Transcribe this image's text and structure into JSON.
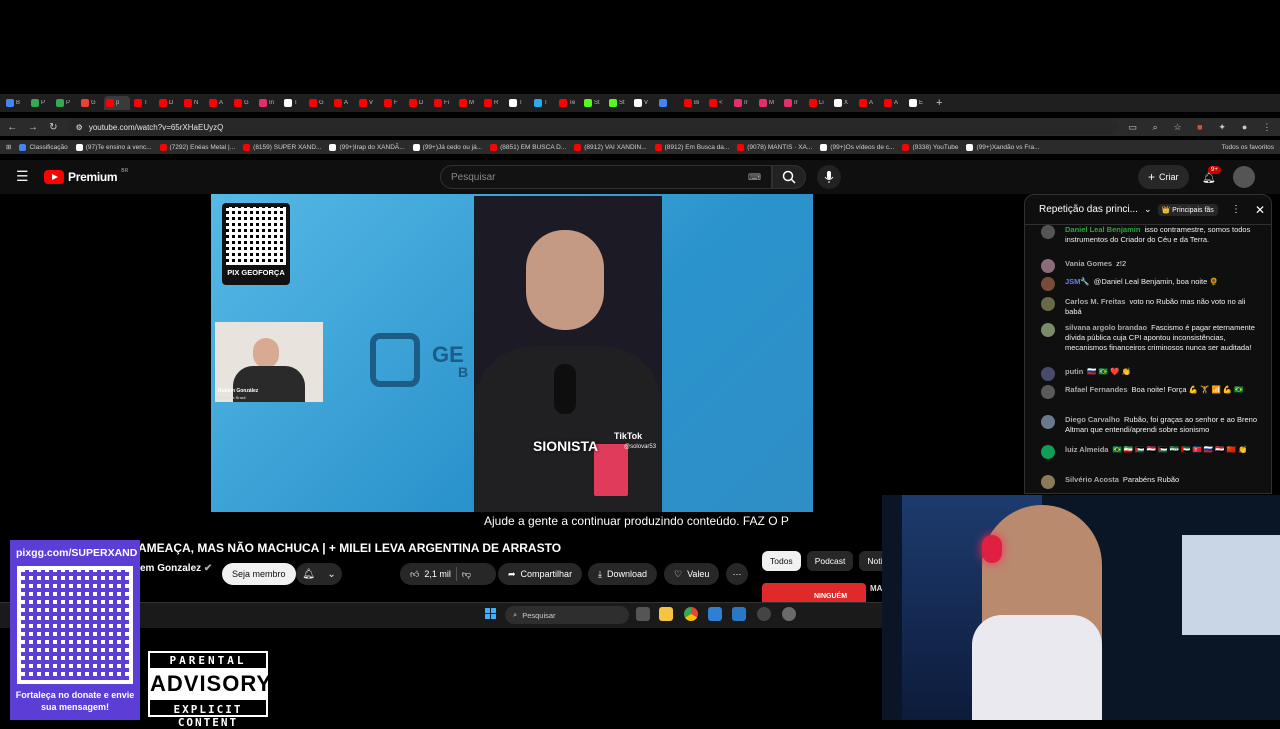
{
  "browser": {
    "tabs": [
      {
        "label": "B",
        "color": "#4285f4"
      },
      {
        "label": "P",
        "color": "#34a853"
      },
      {
        "label": "P",
        "color": "#34a853"
      },
      {
        "label": "G",
        "color": "#ea4335"
      },
      {
        "label": "p",
        "color": "#ff0000"
      },
      {
        "label": "T",
        "color": "#ff0000"
      },
      {
        "label": "D",
        "color": "#ff0000"
      },
      {
        "label": "N",
        "color": "#ff0000"
      },
      {
        "label": "A",
        "color": "#ff0000"
      },
      {
        "label": "G",
        "color": "#ff0000"
      },
      {
        "label": "In",
        "color": "#e1306c"
      },
      {
        "label": "T",
        "color": "#ffffff"
      },
      {
        "label": "G",
        "color": "#ff0000"
      },
      {
        "label": "A",
        "color": "#ff0000"
      },
      {
        "label": "V",
        "color": "#ff0000"
      },
      {
        "label": "F",
        "color": "#ff0000"
      },
      {
        "label": "D",
        "color": "#ff0000"
      },
      {
        "label": "Fi",
        "color": "#ff0000"
      },
      {
        "label": "M",
        "color": "#ff0000"
      },
      {
        "label": "R",
        "color": "#ff0000"
      },
      {
        "label": "T",
        "color": "#ffffff"
      },
      {
        "label": "T",
        "color": "#2aabee"
      },
      {
        "label": "Te",
        "color": "#ff0000"
      },
      {
        "label": "St",
        "color": "#53fc18"
      },
      {
        "label": "St",
        "color": "#53fc18"
      },
      {
        "label": "V",
        "color": "#ffffff"
      },
      {
        "label": "",
        "color": "#4285f4"
      },
      {
        "label": "Bi",
        "color": "#ff0000"
      },
      {
        "label": "<",
        "color": "#ff0000"
      },
      {
        "label": "Ir",
        "color": "#e1306c"
      },
      {
        "label": "M",
        "color": "#e1306c"
      },
      {
        "label": "Ir",
        "color": "#e1306c"
      },
      {
        "label": "Li",
        "color": "#ff0000"
      },
      {
        "label": "X",
        "color": "#ffffff"
      },
      {
        "label": "A",
        "color": "#ff0000"
      },
      {
        "label": "A",
        "color": "#ff0000"
      },
      {
        "label": "E",
        "color": "#ffffff"
      }
    ],
    "url": "youtube.com/watch?v=65rXHaEUyzQ",
    "bookmarks": [
      {
        "label": "Classificação",
        "color": "#4285f4"
      },
      {
        "label": "(97)Te ensino a venc...",
        "color": "#ffffff"
      },
      {
        "label": "(7292) Enéas Metal |...",
        "color": "#ff0000"
      },
      {
        "label": "(8159) SUPER XAND...",
        "color": "#ff0000"
      },
      {
        "label": "(99+)Irap do XANDÃ...",
        "color": "#ffffff"
      },
      {
        "label": "(99+)Já cedo ou já...",
        "color": "#ffffff"
      },
      {
        "label": "(8851) EM BUSCA D...",
        "color": "#ff0000"
      },
      {
        "label": "(8912) VAI XANDIN...",
        "color": "#ff0000"
      },
      {
        "label": "(8912) Em Busca da...",
        "color": "#ff0000"
      },
      {
        "label": "(9078) MANTIS · XA...",
        "color": "#ff0000"
      },
      {
        "label": "(99+)Os vídeos de c...",
        "color": "#ffffff"
      },
      {
        "label": "(9338) YouTube",
        "color": "#ff0000"
      },
      {
        "label": "(99+)Xandão vs Fra...",
        "color": "#ffffff"
      }
    ],
    "all_bookmarks": "Todos os favoritos"
  },
  "youtube": {
    "brand": "Premium",
    "country": "BR",
    "search_placeholder": "Pesquisar",
    "create_label": "Criar",
    "notif_count": "9+"
  },
  "video": {
    "qr_caption": "PIX GEOFORÇA",
    "pip_name": "Rubem González",
    "pip_sub": "Geoforça Brasil",
    "logo_text": "GE",
    "logo_sub": "B",
    "overlay_word": "SIONISTA",
    "tiktok_label": "TikTok",
    "tiktok_user": "@solovar53",
    "subtitle": "Ajude a gente a continuar produzindo conteúdo. FAZ O P"
  },
  "below": {
    "title": "AMEAÇA, MAS NÃO MACHUCA | + MILEI LEVA ARGENTINA DE ARRASTO",
    "channel": "em Gonzalez",
    "join_label": "Seja membro",
    "likes": "2,1 mil",
    "share": "Compartilhar",
    "download": "Download",
    "thanks": "Valeu",
    "chips": [
      "Todos",
      "Podcast",
      "Notí"
    ],
    "thumb_text": "NINGUÉM",
    "thumb_title": "MA VA"
  },
  "taskbar": {
    "search": "Pesquisar"
  },
  "donate": {
    "url": "pixgg.com/SUPERXAND",
    "message": "Fortaleça no donate e envie sua mensagem!"
  },
  "advisory": {
    "line1": "PARENTAL",
    "line2": "ADVISORY",
    "line3": "EXPLICIT CONTENT"
  },
  "chat": {
    "title": "Repetição das princi...",
    "filter": "👑 Principais fãs",
    "messages": [
      {
        "author": "Daniel Leal Benjamin",
        "style": "green",
        "text": "isso contramestre, somos todos instrumentos do Criador do Céu e da Terra.",
        "color": "#555"
      },
      {
        "author": "Vania Gomes",
        "style": "",
        "text": "z!2",
        "color": "#8a6d7a"
      },
      {
        "author": "JSM🔧",
        "style": "blue",
        "text": "@Daniel Leal Benjamin, boa noite 🌻",
        "color": "#7a4a3a"
      },
      {
        "author": "Carlos M. Freitas",
        "style": "",
        "text": "voto no Rubão mas não voto no ali babá",
        "color": "#6a6a4a"
      },
      {
        "author": "silvana argolo brandao",
        "style": "",
        "text": "Fascismo é pagar eternamente dívida pública cuja CPI apontou inconsistências, mecanismos financeiros criminosos nunca ser auditada!",
        "color": "#7a8a6a"
      },
      {
        "author": "putin",
        "style": "",
        "text": "🇷🇺 🇧🇷 ❤️ 👏",
        "color": "#4a4a6a"
      },
      {
        "author": "Rafael Fernandes",
        "style": "",
        "text": "Boa noite! Força 💪 🏋️ 📶 💪 🇧🇷",
        "color": "#5a5a5a"
      },
      {
        "author": "Diego Carvalho",
        "style": "",
        "text": "Rubão, foi graças ao senhor e ao Breno Altman que entendi/aprendi sobre sionismo",
        "color": "#6a7a8a"
      },
      {
        "author": "luiz Almeida",
        "style": "",
        "text": "🇧🇷 🇮🇷 🇵🇸 🇾🇪 🇵🇸 🇸🇾 🇦🇪 🇰🇵 🇷🇺 🇪🇬 🇨🇳 👏",
        "color": "#0f9d58"
      },
      {
        "author": "Silvério Acosta",
        "style": "",
        "text": "Parabéns Rubão",
        "color": "#8a7a5a"
      }
    ]
  }
}
